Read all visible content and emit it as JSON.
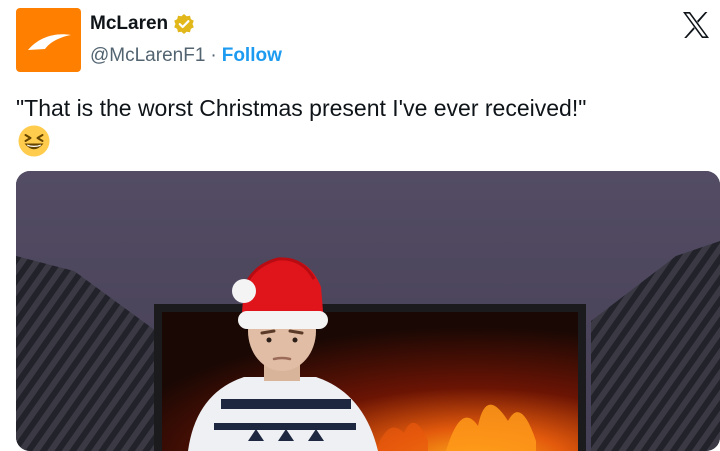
{
  "author": {
    "display_name": "McLaren",
    "handle": "@McLarenF1",
    "separator": "·",
    "follow_label": "Follow",
    "verified": true,
    "brand_color": "#ff8000",
    "verified_color": "#e2b719"
  },
  "platform_icon": "x-logo-icon",
  "tweet": {
    "text": "\"That is the worst Christmas present I've ever received!\"",
    "emoji": "grinning-squinting-face-emoji"
  },
  "media": {
    "type": "photo",
    "alt_icon": "photo"
  },
  "colors": {
    "link": "#1d9bf0",
    "text": "#0f1419",
    "secondary": "#536471"
  }
}
